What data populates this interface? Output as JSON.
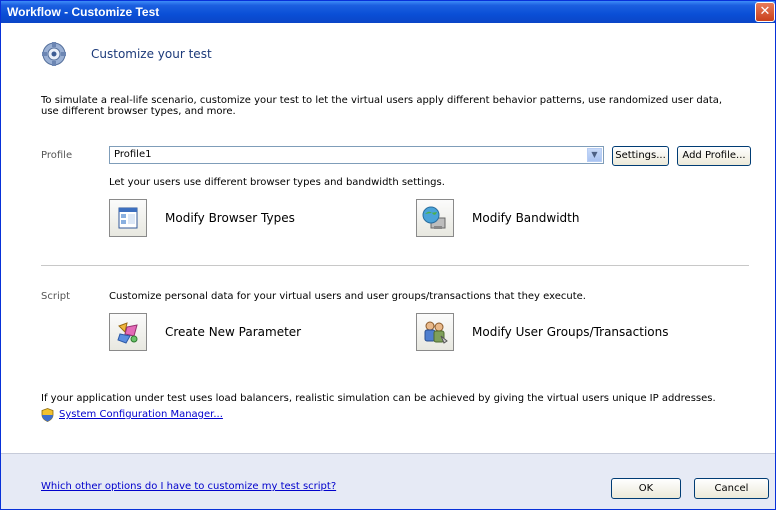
{
  "window": {
    "title": "Workflow - Customize Test",
    "close_glyph": "✕"
  },
  "header": {
    "title": "Customize your test",
    "icon": "settings-gear-icon"
  },
  "intro": "To simulate a real-life scenario, customize your test to let the virtual users apply different behavior patterns, use randomized user data, use different browser types, and more.",
  "profile": {
    "label": "Profile",
    "selected": "Profile1",
    "settings_button": "Settings...",
    "add_profile_button": "Add Profile...",
    "hint": "Let your users use different browser types and bandwidth settings.",
    "actions": [
      {
        "label": "Modify Browser Types",
        "icon": "browser-window-icon"
      },
      {
        "label": "Modify Bandwidth",
        "icon": "network-globe-icon"
      }
    ]
  },
  "script": {
    "label": "Script",
    "hint": "Customize personal data for your virtual users and user groups/transactions that they execute.",
    "actions": [
      {
        "label": "Create New Parameter",
        "icon": "parameter-puzzle-icon"
      },
      {
        "label": "Modify User Groups/Transactions",
        "icon": "user-groups-icon"
      }
    ]
  },
  "ip_text": "If your application under test uses load balancers, realistic simulation can be achieved by giving the virtual users unique IP addresses.",
  "system_config_link": "System Configuration Manager...",
  "footer": {
    "help_link": "Which other options do I have to customize my test script?",
    "ok_button": "OK",
    "cancel_button": "Cancel"
  },
  "colors": {
    "titlebar": "#0a4fd6",
    "link": "#0000cc",
    "footer_bg": "#e6eaf5"
  }
}
